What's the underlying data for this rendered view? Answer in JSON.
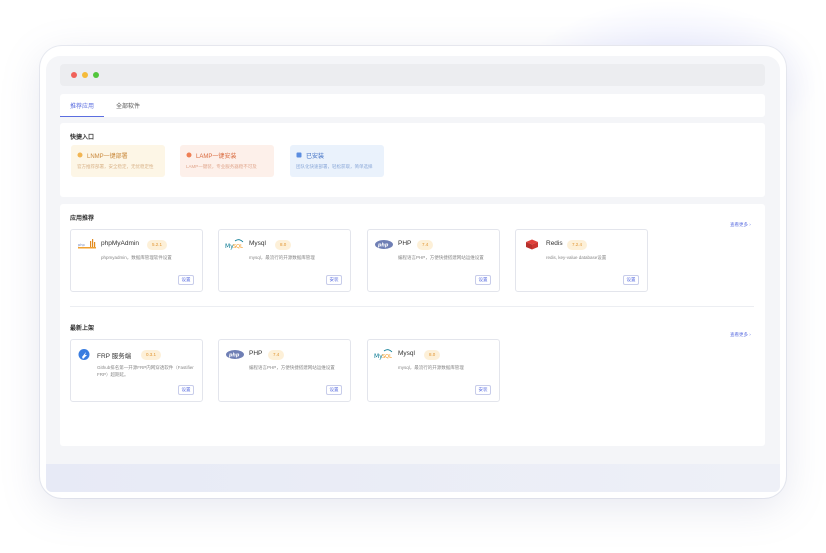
{
  "tabs": [
    {
      "label": "推荐应用"
    },
    {
      "label": "全部软件"
    }
  ],
  "quick_entry": {
    "title": "快捷入口",
    "items": [
      {
        "title": "LNMP一键部署",
        "desc": "官方推荐部署，安全稳定，无忧稳定性"
      },
      {
        "title": "LAMP一键安装",
        "desc": "LAMP一键装，专业服务器稳不可及"
      },
      {
        "title": "已安装",
        "desc": "团队化快速部署，轻松获取，简单选择"
      }
    ]
  },
  "recommended": {
    "title": "应用推荐",
    "more_label": "查看更多",
    "cards": [
      {
        "name": "phpMyAdmin",
        "version": "5.2.1",
        "desc": "phpmyadmin，数据库管理软件设置",
        "button": "设置",
        "icon": "phpmyadmin-icon"
      },
      {
        "name": "Mysql",
        "version": "8.0",
        "desc": "mysql，最流行的开源数据库管理",
        "button": "安装",
        "icon": "mysql-icon"
      },
      {
        "name": "PHP",
        "version": "7.4",
        "desc": "编程语言PHP，方便快捷搭建网站运维设置",
        "button": "设置",
        "icon": "php-icon"
      },
      {
        "name": "Redis",
        "version": "7.2.4",
        "desc": "redis, key-value database设置",
        "button": "设置",
        "icon": "redis-icon"
      }
    ]
  },
  "latest": {
    "title": "最新上架",
    "more_label": "查看更多",
    "cards": [
      {
        "name": "FRP 服务端",
        "version": "0.3.1",
        "desc": "Github排名第一开源FRP内网穿透软件（Fastifier FRP）超期延。",
        "button": "设置",
        "icon": "frp-icon"
      },
      {
        "name": "PHP",
        "version": "7.4",
        "desc": "编程语言PHP，方便快捷搭建网站运维设置",
        "button": "设置",
        "icon": "php-icon"
      },
      {
        "name": "Mysql",
        "version": "8.0",
        "desc": "mysql，最流行的开源数据库管理",
        "button": "安装",
        "icon": "mysql-icon"
      }
    ]
  },
  "colors": {
    "accent": "#5b6ee0",
    "version_bg": "#fdf0d8",
    "version_text": "#e09430"
  }
}
